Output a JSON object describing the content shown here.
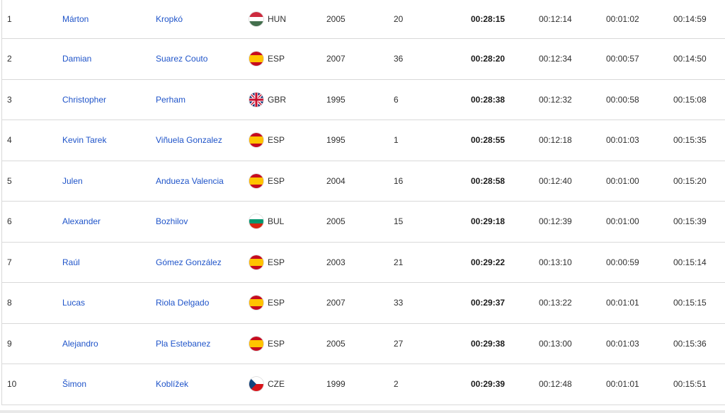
{
  "rows": [
    {
      "rank": "1",
      "first": "Márton",
      "last": "Kropkó",
      "country": "HUN",
      "flag": "hun-flag-icon",
      "year": "2005",
      "bib": "20",
      "time": "00:28:15",
      "s1": "00:12:14",
      "s2": "00:01:02",
      "s3": "00:14:59"
    },
    {
      "rank": "2",
      "first": "Damian",
      "last": "Suarez Couto",
      "country": "ESP",
      "flag": "esp-flag-icon",
      "year": "2007",
      "bib": "36",
      "time": "00:28:20",
      "s1": "00:12:34",
      "s2": "00:00:57",
      "s3": "00:14:50"
    },
    {
      "rank": "3",
      "first": "Christopher",
      "last": "Perham",
      "country": "GBR",
      "flag": "gbr-flag-icon",
      "year": "1995",
      "bib": "6",
      "time": "00:28:38",
      "s1": "00:12:32",
      "s2": "00:00:58",
      "s3": "00:15:08"
    },
    {
      "rank": "4",
      "first": "Kevin Tarek",
      "last": "Viñuela Gonzalez",
      "country": "ESP",
      "flag": "esp-flag-icon",
      "year": "1995",
      "bib": "1",
      "time": "00:28:55",
      "s1": "00:12:18",
      "s2": "00:01:03",
      "s3": "00:15:35"
    },
    {
      "rank": "5",
      "first": "Julen",
      "last": "Andueza Valencia",
      "country": "ESP",
      "flag": "esp-flag-icon",
      "year": "2004",
      "bib": "16",
      "time": "00:28:58",
      "s1": "00:12:40",
      "s2": "00:01:00",
      "s3": "00:15:20"
    },
    {
      "rank": "6",
      "first": "Alexander",
      "last": "Bozhilov",
      "country": "BUL",
      "flag": "bul-flag-icon",
      "year": "2005",
      "bib": "15",
      "time": "00:29:18",
      "s1": "00:12:39",
      "s2": "00:01:00",
      "s3": "00:15:39"
    },
    {
      "rank": "7",
      "first": "Raúl",
      "last": "Gómez González",
      "country": "ESP",
      "flag": "esp-flag-icon",
      "year": "2003",
      "bib": "21",
      "time": "00:29:22",
      "s1": "00:13:10",
      "s2": "00:00:59",
      "s3": "00:15:14"
    },
    {
      "rank": "8",
      "first": "Lucas",
      "last": "Riola Delgado",
      "country": "ESP",
      "flag": "esp-flag-icon",
      "year": "2007",
      "bib": "33",
      "time": "00:29:37",
      "s1": "00:13:22",
      "s2": "00:01:01",
      "s3": "00:15:15"
    },
    {
      "rank": "9",
      "first": "Alejandro",
      "last": "Pla Estebanez",
      "country": "ESP",
      "flag": "esp-flag-icon",
      "year": "2005",
      "bib": "27",
      "time": "00:29:38",
      "s1": "00:13:00",
      "s2": "00:01:03",
      "s3": "00:15:36"
    },
    {
      "rank": "10",
      "first": "Šimon",
      "last": "Koblížek",
      "country": "CZE",
      "flag": "cze-flag-icon",
      "year": "1999",
      "bib": "2",
      "time": "00:29:39",
      "s1": "00:12:48",
      "s2": "00:01:01",
      "s3": "00:15:51"
    }
  ],
  "colors": {
    "link": "#1f54c9",
    "text": "#2f2f2f",
    "border": "#d9d9d9"
  }
}
